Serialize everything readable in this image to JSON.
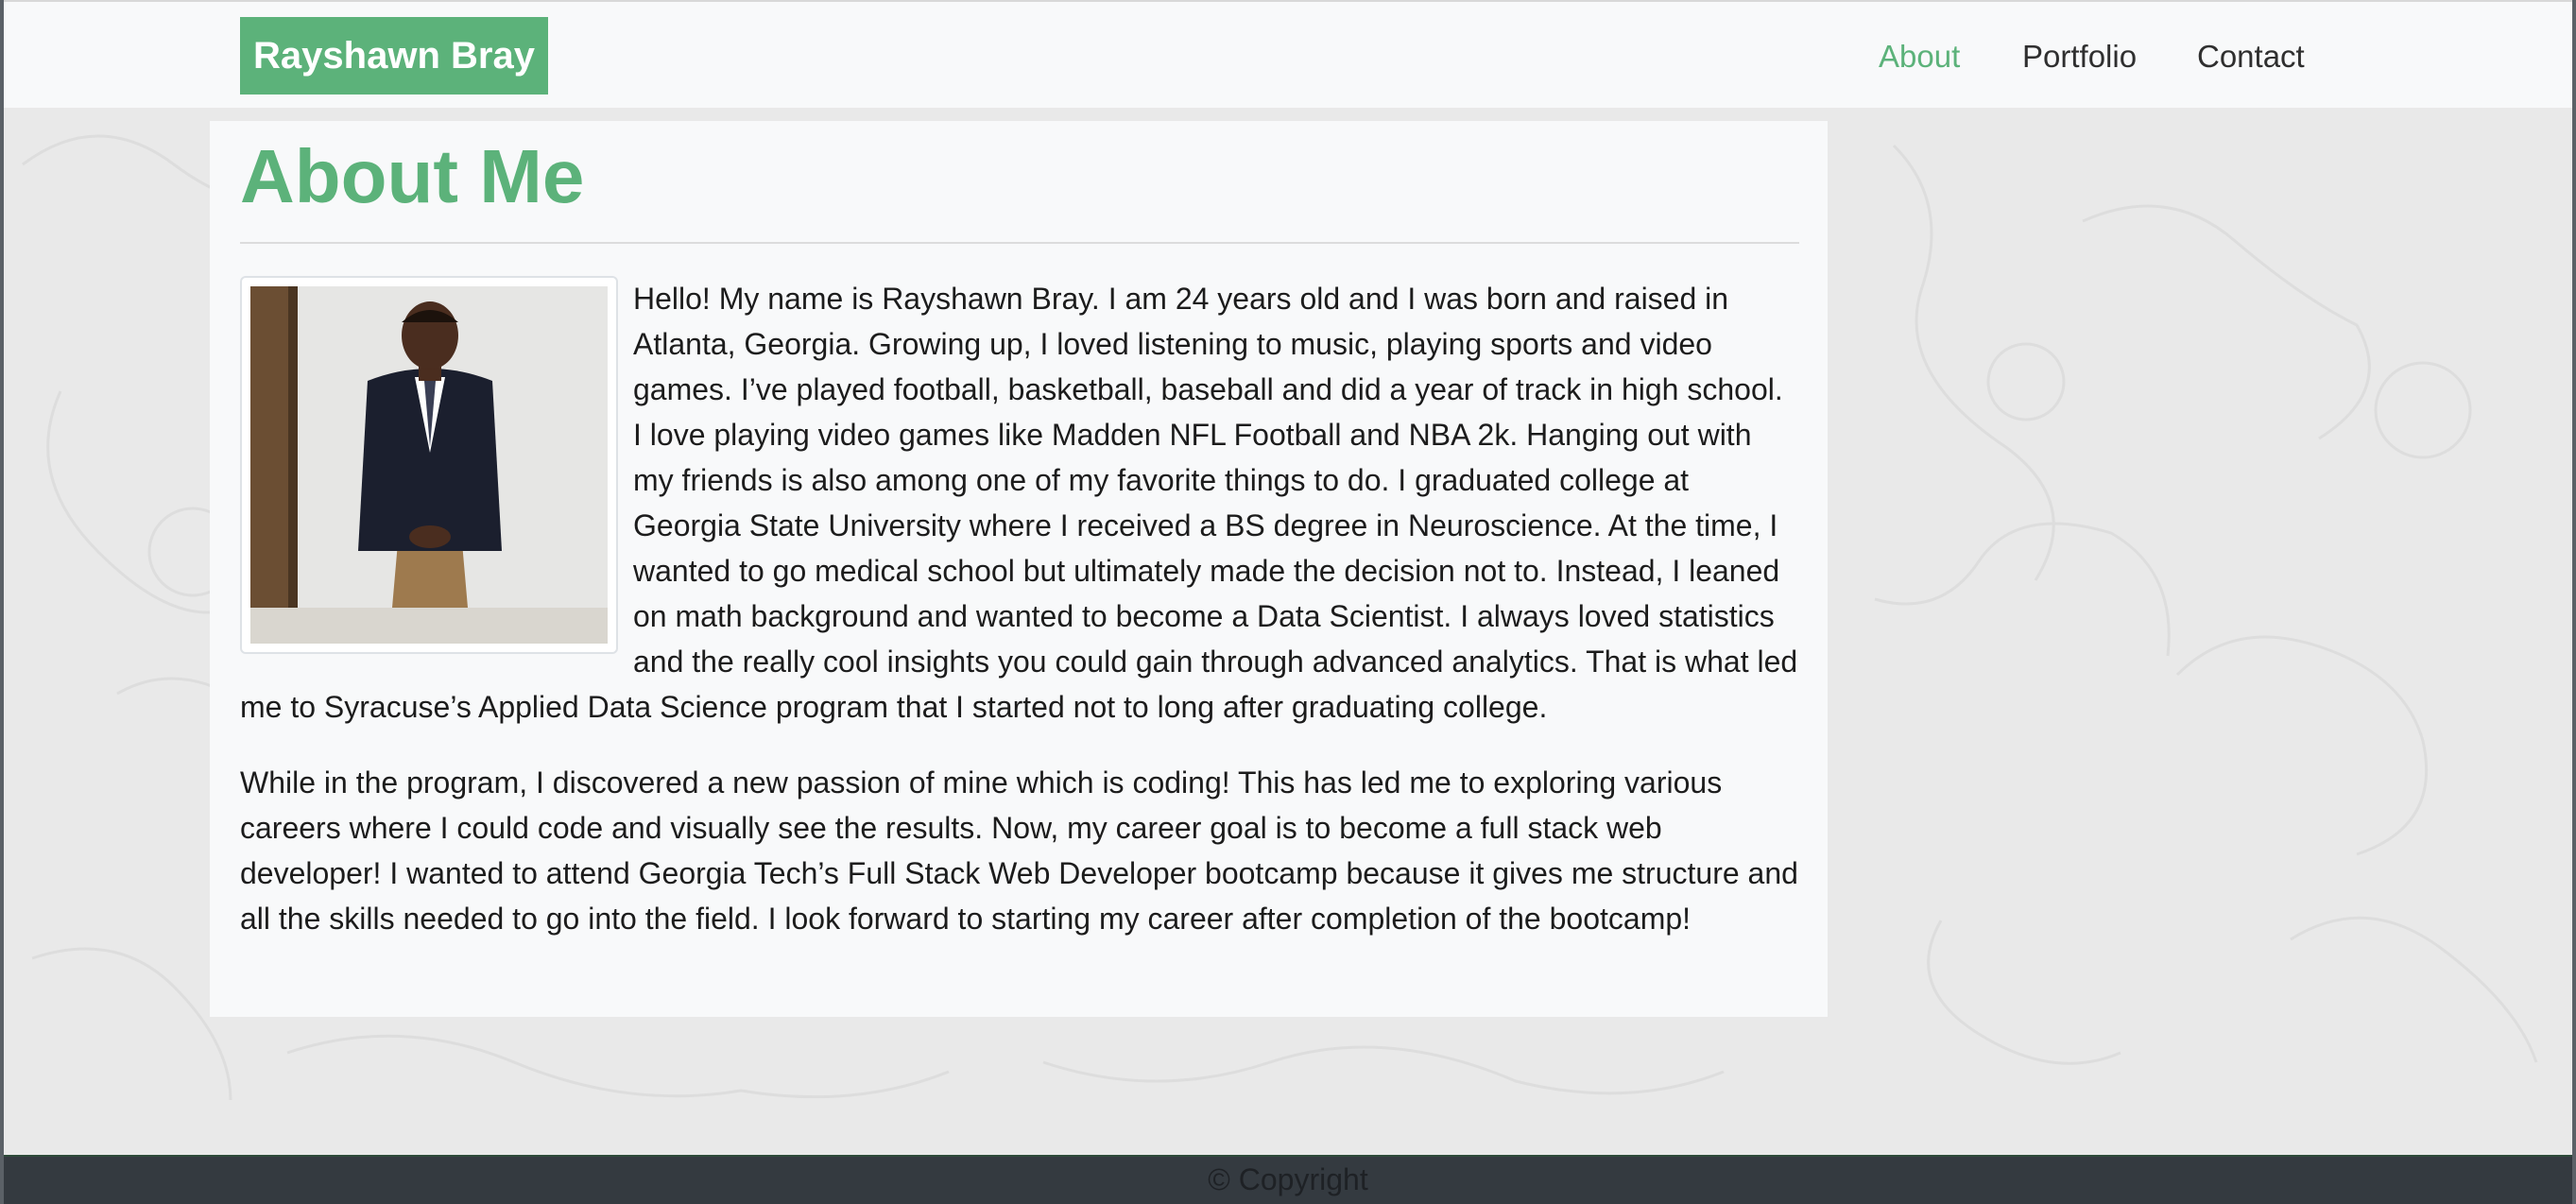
{
  "navbar": {
    "brand": "Rayshawn Bray",
    "links": [
      {
        "label": "About",
        "active": true
      },
      {
        "label": "Portfolio",
        "active": false
      },
      {
        "label": "Contact",
        "active": false
      }
    ]
  },
  "main": {
    "title": "About Me",
    "paragraphs": [
      "Hello! My name is Rayshawn Bray. I am 24 years old and I was born and raised in Atlanta, Georgia. Growing up, I loved listening to music, playing sports and video games. I’ve played football, basketball, baseball and did a year of track in high school. I love playing video games like Madden NFL Football and NBA 2k. Hanging out with my friends is also among one of my favorite things to do. I graduated college at Georgia State University where I received a BS degree in Neuroscience. At the time, I wanted to go medical school but ultimately made the decision not to. Instead, I leaned on math background and wanted to become a Data Scientist. I always loved statistics and the really cool insights you could gain through advanced analytics. That is what led me to Syracuse’s Applied Data Science program that I started not to long after graduating college.",
      "While in the program, I discovered a new passion of mine which is coding! This has led me to exploring various careers where I could code and visually see the results. Now, my career goal is to become a full stack web developer! I wanted to attend Georgia Tech’s Full Stack Web Developer bootcamp because it gives me structure and all the skills needed to go into the field. I look forward to starting my career after completion of the bootcamp!"
    ]
  },
  "footer": {
    "text": "© Copyright"
  },
  "colors": {
    "accent": "#5cb27a",
    "navbar_bg": "#f8f9fa",
    "page_bg": "#e9e9e9",
    "footer_bg": "#343a40"
  }
}
